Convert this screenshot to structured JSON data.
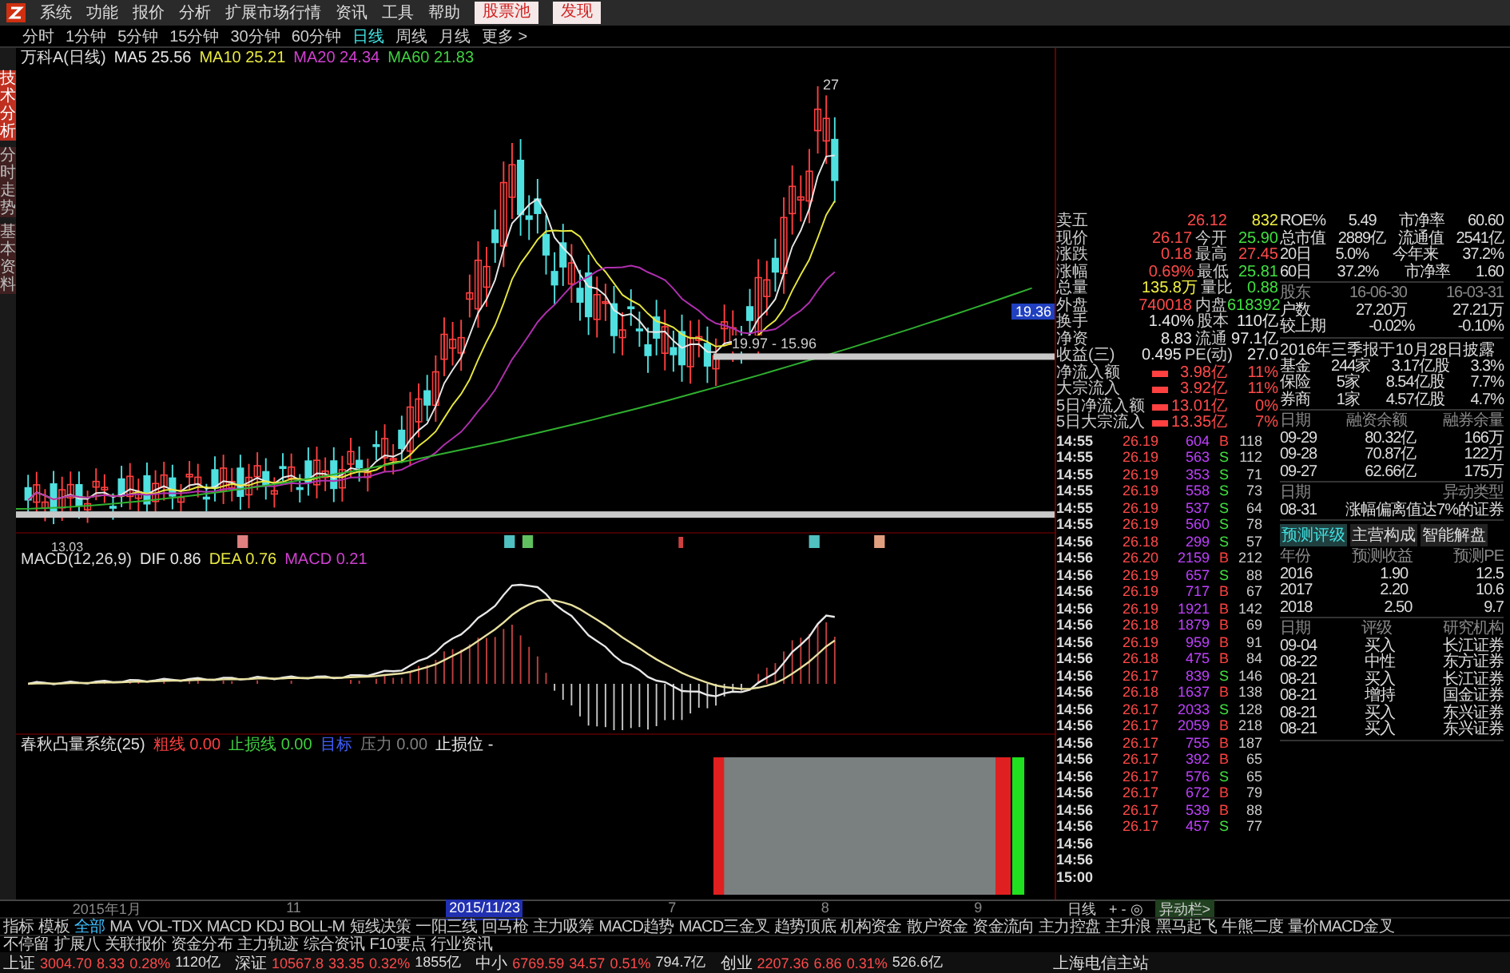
{
  "menu": {
    "items": [
      "系统",
      "功能",
      "报价",
      "分析",
      "扩展市场行情",
      "资讯",
      "工具",
      "帮助"
    ],
    "buttons": [
      "股票池",
      "发现"
    ]
  },
  "periods": [
    {
      "label": "分时",
      "selected": false
    },
    {
      "label": "1分钟",
      "selected": false
    },
    {
      "label": "5分钟",
      "selected": false
    },
    {
      "label": "15分钟",
      "selected": false
    },
    {
      "label": "30分钟",
      "selected": false
    },
    {
      "label": "60分钟",
      "selected": false
    },
    {
      "label": "日线",
      "selected": true
    },
    {
      "label": "周线",
      "selected": false
    },
    {
      "label": "月线",
      "selected": false
    },
    {
      "label": "更多 >",
      "selected": false
    }
  ],
  "side_tabs": [
    {
      "label": "技术分析",
      "selected": true
    },
    {
      "label": "分时走势",
      "selected": false
    },
    {
      "label": "基本资料",
      "selected": false
    }
  ],
  "legend": {
    "title": "万科A(日线)",
    "items": [
      {
        "text": "MA5 25.56",
        "color": "#e8e8e8"
      },
      {
        "text": "MA10 25.21",
        "color": "#e8e840"
      },
      {
        "text": "MA20 24.34",
        "color": "#d040d0"
      },
      {
        "text": "MA60 21.83",
        "color": "#40d040"
      }
    ]
  },
  "price_chart": {
    "high_label": "27",
    "low_label": "13.03",
    "range_label": "19.97 - 15.96",
    "axis_label": "19.36"
  },
  "macd": {
    "title": "MACD(12,26,9)",
    "items": [
      {
        "text": "DIF 0.86",
        "color": "#e8e8e8"
      },
      {
        "text": "DEA 0.76",
        "color": "#e8e840"
      },
      {
        "text": "MACD 0.21",
        "color": "#d040d0"
      }
    ]
  },
  "indicator": {
    "title": "春秋凸量系统(25)",
    "items": [
      {
        "text": "粗线 0.00",
        "color": "#ff4040"
      },
      {
        "text": "止损线 0.00",
        "color": "#40d040"
      },
      {
        "text": "目标",
        "color": "#4060ff"
      },
      {
        "text": "压力 0.00",
        "color": "#808080"
      },
      {
        "text": "止损位 -",
        "color": "#e8e8e8"
      }
    ]
  },
  "date_axis": [
    {
      "label": "2015年1月",
      "selected": false
    },
    {
      "label": "11",
      "selected": false
    },
    {
      "label": "2015/11/23",
      "selected": true
    },
    {
      "label": "7",
      "selected": false
    },
    {
      "label": "8",
      "selected": false
    },
    {
      "label": "9",
      "selected": false
    }
  ],
  "indicator_tabs": [
    {
      "label": "指标",
      "selected": false
    },
    {
      "label": "模板",
      "selected": false
    },
    {
      "label": "全部",
      "selected": true
    },
    {
      "label": "MA",
      "selected": false
    },
    {
      "label": "VOL-TDX",
      "selected": false
    },
    {
      "label": "MACD",
      "selected": false
    },
    {
      "label": "KDJ",
      "selected": false
    },
    {
      "label": "BOLL-M",
      "selected": false
    },
    {
      "label": "短线决策",
      "selected": false
    },
    {
      "label": "一阳三线",
      "selected": false
    },
    {
      "label": "回马枪",
      "selected": false
    },
    {
      "label": "主力吸筹",
      "selected": false
    },
    {
      "label": "MACD趋势",
      "selected": false
    },
    {
      "label": "MACD三金叉",
      "selected": false
    },
    {
      "label": "趋势顶底",
      "selected": false
    },
    {
      "label": "机构资金",
      "selected": false
    },
    {
      "label": "散户资金",
      "selected": false
    },
    {
      "label": "资金流向",
      "selected": false
    },
    {
      "label": "主力控盘",
      "selected": false
    },
    {
      "label": "主升浪",
      "selected": false
    },
    {
      "label": "黑马起飞",
      "selected": false
    },
    {
      "label": "牛熊二度",
      "selected": false
    },
    {
      "label": "量价MACD金叉",
      "selected": false
    }
  ],
  "bottom_tabs": [
    {
      "label": "不停留",
      "selected": false
    },
    {
      "label": "扩展八",
      "selected": false
    },
    {
      "label": "关联报价",
      "selected": false
    },
    {
      "label": "资金分布",
      "selected": false
    },
    {
      "label": "主力轨迹",
      "selected": false
    },
    {
      "label": "综合资讯",
      "selected": false
    },
    {
      "label": "F10要点",
      "selected": false
    },
    {
      "label": "行业资讯",
      "selected": false
    }
  ],
  "corner": {
    "period": "日线",
    "zoom": "+ - ◎",
    "alerts": "异动栏>"
  },
  "status_bar": {
    "indices": [
      {
        "name": "上证",
        "value": "3004.70",
        "change": "8.33",
        "percent": "0.28%",
        "amount": "1120亿"
      },
      {
        "name": "深证",
        "value": "10567.8",
        "change": "33.35",
        "percent": "0.32%",
        "amount": "1855亿"
      },
      {
        "name": "中小",
        "value": "6769.59",
        "change": "34.57",
        "percent": "0.51%",
        "amount": "794.7亿"
      },
      {
        "name": "创业",
        "value": "2207.36",
        "change": "6.86",
        "percent": "0.31%",
        "amount": "526.6亿"
      }
    ],
    "server": "上海电信主站"
  },
  "quote": [
    {
      "kind": "pair",
      "label": "卖五",
      "value": {
        "text": "26.12",
        "color": "#ff4a4a"
      },
      "value2": {
        "text": "832",
        "color": "#f0f040"
      }
    },
    {
      "kind": "pair",
      "label": "现价",
      "value": {
        "text": "26.17",
        "color": "#ff4a4a"
      },
      "label2": "今开",
      "value2": {
        "text": "25.90",
        "color": "#40e040"
      }
    },
    {
      "kind": "pair",
      "label": "涨跌",
      "value": {
        "text": "0.18",
        "color": "#ff4a4a"
      },
      "label2": "最高",
      "value2": {
        "text": "27.45",
        "color": "#ff4a4a"
      }
    },
    {
      "kind": "pair",
      "label": "涨幅",
      "value": {
        "text": "0.69%",
        "color": "#ff4a4a"
      },
      "label2": "最低",
      "value2": {
        "text": "25.81",
        "color": "#40e040"
      }
    },
    {
      "kind": "pair",
      "label": "总量",
      "value": {
        "text": "135.8万",
        "color": "#f0f040"
      },
      "label2": "量比",
      "value2": {
        "text": "0.88",
        "color": "#40e040"
      }
    },
    {
      "kind": "pair",
      "label": "外盘",
      "value": {
        "text": "740018",
        "color": "#ff4a4a"
      },
      "label2": "内盘",
      "value2": {
        "text": "618392",
        "color": "#40e040"
      }
    },
    {
      "kind": "pair",
      "label": "换手",
      "value": {
        "text": "1.40%",
        "color": "#e8e8e8"
      },
      "label2": "股本",
      "value2": {
        "text": "110亿",
        "color": "#e8e8e8"
      }
    },
    {
      "kind": "pair",
      "label": "净资",
      "value": {
        "text": "8.83",
        "color": "#e8e8e8"
      },
      "label2": "流通",
      "value2": {
        "text": "97.1亿",
        "color": "#e8e8e8"
      }
    },
    {
      "kind": "pair",
      "label": "收益(三)",
      "value": {
        "text": "0.495",
        "color": "#e8e8e8"
      },
      "label2": "PE(动)",
      "value2": {
        "text": "27.0",
        "color": "#e8e8e8"
      }
    },
    {
      "kind": "flow",
      "label": "净流入额",
      "value": {
        "text": "3.98亿",
        "color": "#ff4a4a"
      },
      "value2": {
        "text": "11%",
        "color": "#ff4a4a"
      }
    },
    {
      "kind": "flow",
      "label": "大宗流入",
      "value": {
        "text": "3.92亿",
        "color": "#ff4a4a"
      },
      "value2": {
        "text": "11%",
        "color": "#ff4a4a"
      }
    },
    {
      "kind": "flow",
      "label": "5日净流入额",
      "value": {
        "text": "13.01亿",
        "color": "#ff4a4a"
      },
      "value2": {
        "text": "0%",
        "color": "#ff4a4a"
      }
    },
    {
      "kind": "flow",
      "label": "5日大宗流入",
      "value": {
        "text": "13.35亿",
        "color": "#ff4a4a"
      },
      "value2": {
        "text": "7%",
        "color": "#ff4a4a"
      }
    }
  ],
  "ticks": [
    {
      "time": "14:55",
      "price": "26.19",
      "volume": "604",
      "side": "B",
      "color": "#ff4040",
      "count": "118"
    },
    {
      "time": "14:55",
      "price": "26.19",
      "volume": "563",
      "side": "S",
      "color": "#40e040",
      "count": "112"
    },
    {
      "time": "14:55",
      "price": "26.19",
      "volume": "353",
      "side": "S",
      "color": "#40e040",
      "count": "71"
    },
    {
      "time": "14:55",
      "price": "26.19",
      "volume": "558",
      "side": "S",
      "color": "#40e040",
      "count": "73"
    },
    {
      "time": "14:55",
      "price": "26.19",
      "volume": "537",
      "side": "S",
      "color": "#40e040",
      "count": "64"
    },
    {
      "time": "14:55",
      "price": "26.19",
      "volume": "560",
      "side": "S",
      "color": "#40e040",
      "count": "78"
    },
    {
      "time": "14:56",
      "price": "26.18",
      "volume": "299",
      "side": "S",
      "color": "#40e040",
      "count": "57"
    },
    {
      "time": "14:56",
      "price": "26.20",
      "volume": "2159",
      "side": "B",
      "color": "#ff4040",
      "count": "212"
    },
    {
      "time": "14:56",
      "price": "26.19",
      "volume": "657",
      "side": "S",
      "color": "#40e040",
      "count": "88"
    },
    {
      "time": "14:56",
      "price": "26.19",
      "volume": "717",
      "side": "B",
      "color": "#ff4040",
      "count": "67"
    },
    {
      "time": "14:56",
      "price": "26.19",
      "volume": "1921",
      "side": "B",
      "color": "#ff4040",
      "count": "142"
    },
    {
      "time": "14:56",
      "price": "26.18",
      "volume": "1879",
      "side": "B",
      "color": "#ff4040",
      "count": "69"
    },
    {
      "time": "14:56",
      "price": "26.19",
      "volume": "959",
      "side": "B",
      "color": "#ff4040",
      "count": "91"
    },
    {
      "time": "14:56",
      "price": "26.18",
      "volume": "475",
      "side": "B",
      "color": "#ff4040",
      "count": "84"
    },
    {
      "time": "14:56",
      "price": "26.17",
      "volume": "839",
      "side": "S",
      "color": "#40e040",
      "count": "146"
    },
    {
      "time": "14:56",
      "price": "26.18",
      "volume": "1637",
      "side": "B",
      "color": "#ff4040",
      "count": "138"
    },
    {
      "time": "14:56",
      "price": "26.17",
      "volume": "2033",
      "side": "S",
      "color": "#40e040",
      "count": "128"
    },
    {
      "time": "14:56",
      "price": "26.17",
      "volume": "2059",
      "side": "B",
      "color": "#ff4040",
      "count": "218"
    },
    {
      "time": "14:56",
      "price": "26.17",
      "volume": "755",
      "side": "B",
      "color": "#ff4040",
      "count": "187"
    },
    {
      "time": "14:56",
      "price": "26.17",
      "volume": "392",
      "side": "B",
      "color": "#ff4040",
      "count": "65"
    },
    {
      "time": "14:56",
      "price": "26.17",
      "volume": "576",
      "side": "S",
      "color": "#40e040",
      "count": "65"
    },
    {
      "time": "14:56",
      "price": "26.17",
      "volume": "672",
      "side": "B",
      "color": "#ff4040",
      "count": "79"
    },
    {
      "time": "14:56",
      "price": "26.17",
      "volume": "539",
      "side": "B",
      "color": "#ff4040",
      "count": "88"
    },
    {
      "time": "14:56",
      "price": "26.17",
      "volume": "457",
      "side": "S",
      "color": "#40e040",
      "count": "77"
    },
    {
      "time": "14:56"
    },
    {
      "time": "14:56"
    },
    {
      "time": "15:00"
    }
  ],
  "fundamentals": [
    {
      "kind": "table",
      "rows": [
        {
          "header": false,
          "cells": [
            "ROE%",
            "5.49",
            "市净率",
            "60.60"
          ]
        },
        {
          "header": false,
          "cells": [
            "总市值",
            "2889亿",
            "流通值",
            "2541亿"
          ]
        },
        {
          "header": false,
          "cells": [
            "20日",
            "5.0%",
            "今年来",
            "37.2%"
          ]
        },
        {
          "header": false,
          "cells": [
            "60日",
            "37.2%",
            "市净率",
            "1.60"
          ]
        }
      ]
    },
    {
      "kind": "table",
      "rows": [
        {
          "header": true,
          "cells": [
            "股东",
            "16-06-30",
            "16-03-31"
          ]
        },
        {
          "header": false,
          "cells": [
            "户数",
            "27.20万",
            "27.21万"
          ]
        },
        {
          "header": false,
          "cells": [
            "较上期",
            "-0.02%",
            "-0.10%"
          ]
        }
      ]
    },
    {
      "kind": "notice",
      "text": "2016年三季报于10月28日披露"
    },
    {
      "kind": "table",
      "rows": [
        {
          "header": false,
          "cells": [
            "基金",
            "244家",
            "3.17亿股",
            "3.3%"
          ]
        },
        {
          "header": false,
          "cells": [
            "保险",
            "5家",
            "8.54亿股",
            "7.7%"
          ]
        },
        {
          "header": false,
          "cells": [
            "券商",
            "1家",
            "4.57亿股",
            "4.7%"
          ]
        }
      ]
    },
    {
      "kind": "table",
      "rows": [
        {
          "header": true,
          "cells": [
            "日期",
            "融资余额",
            "融券余量"
          ]
        },
        {
          "header": false,
          "cells": [
            "09-29",
            "80.32亿",
            "166万"
          ]
        },
        {
          "header": false,
          "cells": [
            "09-28",
            "70.87亿",
            "122万"
          ]
        },
        {
          "header": false,
          "cells": [
            "09-27",
            "62.66亿",
            "175万"
          ]
        }
      ]
    },
    {
      "kind": "table",
      "rows": [
        {
          "header": true,
          "cells": [
            "日期",
            "异动类型"
          ]
        },
        {
          "header": false,
          "cells": [
            "08-31",
            "涨幅偏离值达7%的证券"
          ]
        }
      ]
    },
    {
      "kind": "tabs",
      "tabs": [
        {
          "label": "预测评级",
          "selected": true
        },
        {
          "label": "主营构成",
          "selected": false
        },
        {
          "label": "智能解盘",
          "selected": false
        }
      ]
    },
    {
      "kind": "table",
      "rows": [
        {
          "header": true,
          "cells": [
            "年份",
            "预测收益",
            "预测PE"
          ]
        },
        {
          "header": false,
          "cells": [
            "2016",
            "1.90",
            "12.5"
          ]
        },
        {
          "header": false,
          "cells": [
            "2017",
            "2.20",
            "10.6"
          ]
        },
        {
          "header": false,
          "cells": [
            "2018",
            "2.50",
            "9.7"
          ]
        }
      ]
    },
    {
      "kind": "table",
      "rows": [
        {
          "header": true,
          "cells": [
            "日期",
            "评级",
            "研究机构"
          ]
        },
        {
          "header": false,
          "cells": [
            "09-04",
            "买入",
            "长江证券"
          ]
        },
        {
          "header": false,
          "cells": [
            "08-22",
            "中性",
            "东方证券"
          ]
        },
        {
          "header": false,
          "cells": [
            "08-21",
            "买入",
            "长江证券"
          ]
        },
        {
          "header": false,
          "cells": [
            "08-21",
            "增持",
            "国金证券"
          ]
        },
        {
          "header": false,
          "cells": [
            "08-21",
            "买入",
            "东兴证券"
          ]
        },
        {
          "header": false,
          "cells": [
            "08-21",
            "买入",
            "东兴证券"
          ]
        }
      ]
    }
  ]
}
